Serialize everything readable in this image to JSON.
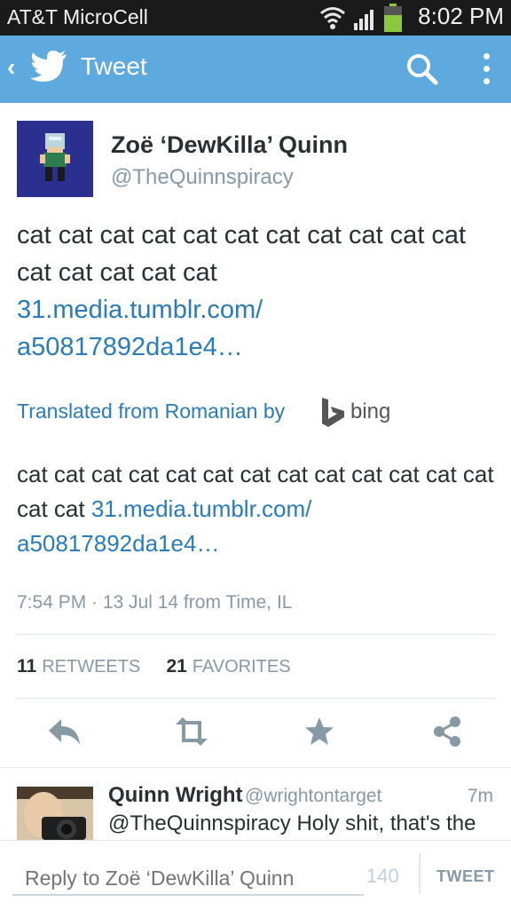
{
  "status_bar": {
    "carrier": "AT&T MicroCell",
    "time": "8:02 PM"
  },
  "action_bar": {
    "title": "Tweet",
    "back_glyph": "‹",
    "icons": [
      "back-icon",
      "twitter-bird-icon",
      "search-icon",
      "overflow-menu-icon"
    ]
  },
  "tweet": {
    "display_name": "Zoë ‘DewKilla’ Quinn",
    "handle": "@TheQuinnspiracy",
    "text": "cat cat cat cat cat cat cat cat cat cat cat cat cat cat cat cat",
    "link_line1": "31.media.tumblr.com/",
    "link_line2": "a50817892da1e4…",
    "translated_label": "Translated from Romanian by",
    "translator": "bing",
    "translation_text": "cat cat cat cat cat cat cat cat cat cat cat cat cat cat cat",
    "translation_link1": "31.media.tumblr.com/",
    "translation_link2": "a50817892da1e4…",
    "timestamp": "7:54 PM · 13 Jul 14 from Time, IL",
    "retweets_count": "11",
    "retweets_label": "RETWEETS",
    "favorites_count": "21",
    "favorites_label": "FAVORITES"
  },
  "actions": [
    "reply-icon",
    "retweet-icon",
    "favorite-star-icon",
    "share-icon"
  ],
  "reply": {
    "name": "Quinn Wright",
    "handle": "@wrightontarget",
    "time": "7m",
    "text": "@TheQuinnspiracy Holy shit, that's the"
  },
  "compose": {
    "placeholder": "Reply to Zoë ‘DewKilla’ Quinn",
    "char_count": "140",
    "tweet_button": "TWEET"
  },
  "colors": {
    "twitter_blue": "#5ea9dd",
    "link_blue": "#2b7bb9",
    "status_bar": "#1a1a1a",
    "battery_green": "#8dc63f"
  }
}
